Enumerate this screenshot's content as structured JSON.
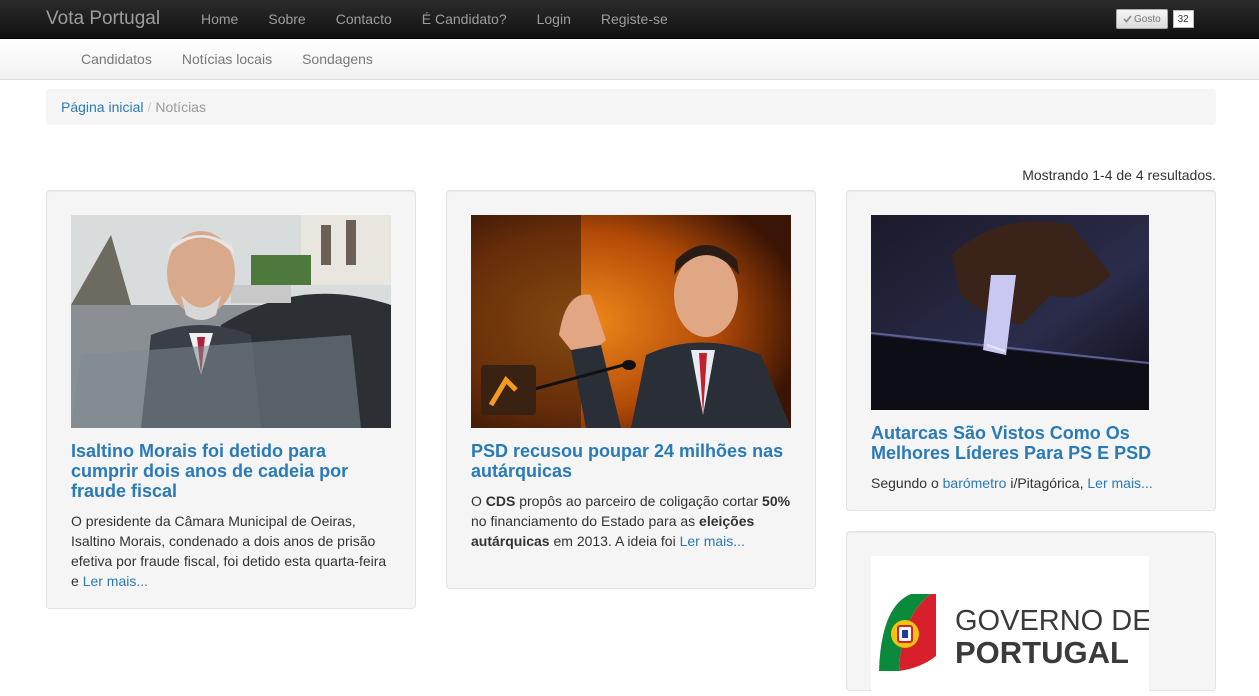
{
  "brand": "Vota Portugal",
  "topnav": [
    "Home",
    "Sobre",
    "Contacto",
    "É Candidato?",
    "Login",
    "Registe-se"
  ],
  "like": {
    "label": "Gosto",
    "count": "32"
  },
  "subnav": [
    "Candidatos",
    "Notícias locais",
    "Sondagens"
  ],
  "breadcrumb": {
    "home": "Página inicial",
    "current": "Notícias"
  },
  "results": "Mostrando 1-4 de 4 resultados.",
  "articles": [
    {
      "title": "Isaltino Morais foi detido para cumprir dois anos de cadeia por fraude fiscal",
      "text": "O presidente da Câmara Municipal de Oeiras, Isaltino Morais, condenado a dois anos de prisão efetiva por fraude fiscal, foi detido esta quarta-feira e ",
      "more": "Ler mais..."
    },
    {
      "title": "PSD recusou poupar 24 milhões nas autárquicas",
      "t1": "O ",
      "b1": "CDS",
      "t2": " propôs ao parceiro de coligação cortar ",
      "b2": "50%",
      "t3": " no financiamento do Estado para as ",
      "b3": "eleições autárquicas",
      "t4": " em 2013. A ideia foi ",
      "more": "Ler mais..."
    },
    {
      "title": "Autarcas São Vistos Como Os Melhores Líderes Para PS E PSD",
      "t1": "Segundo o ",
      "link": "barómetro",
      "t2": " i/Pitagórica, ",
      "more": "Ler mais..."
    },
    {
      "logo_line1": "GOVERNO DE",
      "logo_line2": "PORTUGAL"
    }
  ]
}
